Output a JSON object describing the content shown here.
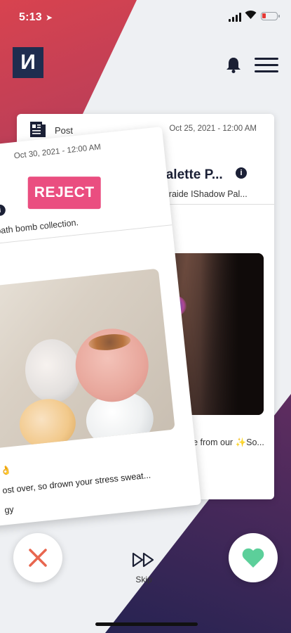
{
  "status_bar": {
    "time": "5:13",
    "location_glyph": "➤"
  },
  "header": {
    "logo_text": "И"
  },
  "back_card": {
    "type_label": "Post",
    "date": "Oct 25, 2021 - 12:00 AM",
    "title": "w Palette P...",
    "subtitle": "r Glitteraide IShadow Pal...",
    "caption": "ere from our ✨So..."
  },
  "front_card": {
    "date": "Oct 30, 2021 - 12:00 AM",
    "stamp": "REJECT",
    "title": "t",
    "subtitle": "ew bath bomb collection.",
    "caption_line1": "👌",
    "caption_line2": "ost over,  so drown your stress sweat...",
    "caption_line3": "gy"
  },
  "actions": {
    "skip_label": "Skip"
  },
  "colors": {
    "accent_reject": "#ea4e80",
    "heart": "#5ccf9a",
    "dislike": "#e8664f",
    "navy": "#1f2d4f"
  }
}
